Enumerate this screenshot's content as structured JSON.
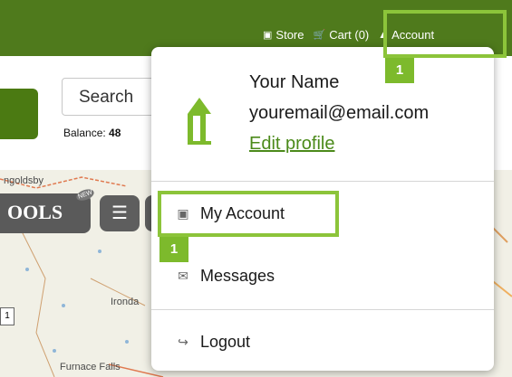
{
  "topnav": {
    "store_label": "Store",
    "cart_label": "Cart (0)",
    "account_label": "Account"
  },
  "header": {
    "search_placeholder": "Search",
    "balance_label": "Balance:",
    "balance_value": "48"
  },
  "map": {
    "labels": [
      "ngoldsby",
      "Ironda",
      "Furnace Falls"
    ],
    "tools_label": "OOLS",
    "new_badge": "NEW",
    "small_box": "1"
  },
  "dropdown": {
    "user_name": "Your Name",
    "user_email": "youremail@email.com",
    "edit_profile": "Edit profile",
    "items": [
      {
        "label": "My Account",
        "icon": "id-card-icon"
      },
      {
        "label": "Messages",
        "icon": "envelope-icon"
      },
      {
        "label": "Logout",
        "icon": "logout-icon"
      }
    ]
  },
  "annotations": {
    "step1_top": "1",
    "step1_menu": "1"
  },
  "colors": {
    "topbar": "#4f7a1c",
    "highlight": "#8cc43a",
    "link": "#4b8a1a"
  }
}
